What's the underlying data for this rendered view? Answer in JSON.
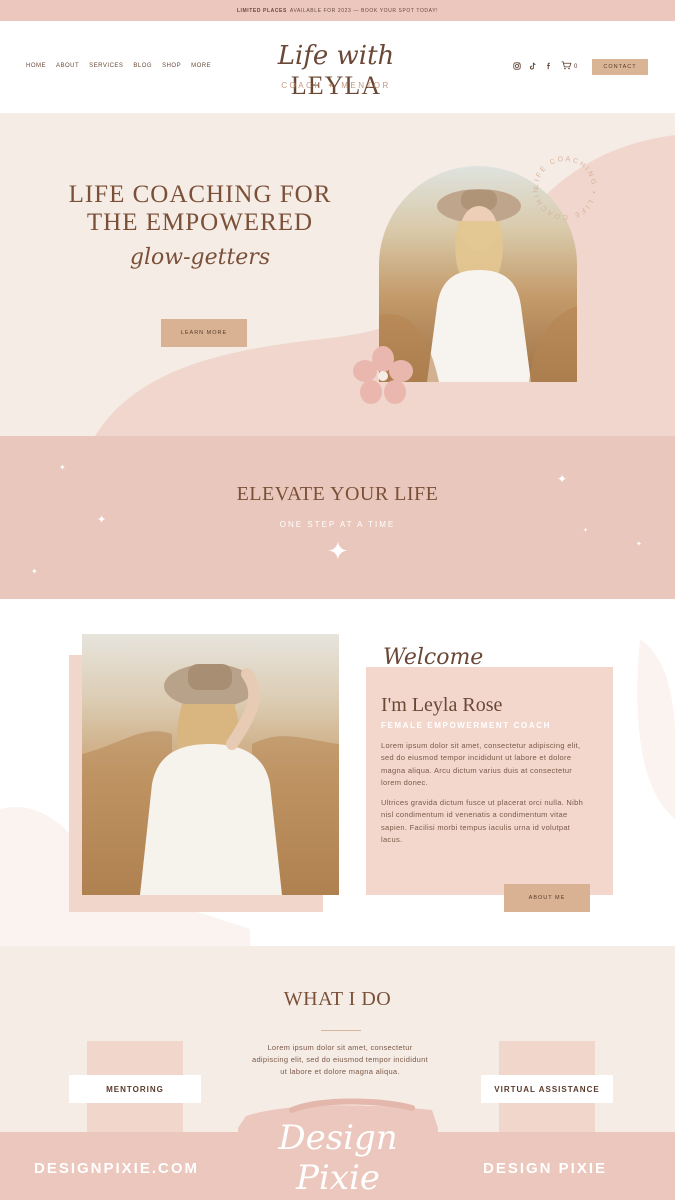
{
  "topbar": {
    "bold": "LIMITED PLACES",
    "rest": "AVAILABLE FOR 2023 — BOOK YOUR SPOT TODAY!"
  },
  "nav": [
    "HOME",
    "ABOUT",
    "SERVICES",
    "BLOG",
    "SHOP",
    "MORE"
  ],
  "logo": {
    "script": "Life with",
    "caps": "LEYLA",
    "sub": "COACH ✦ MENTOR"
  },
  "header": {
    "cart_count": "0",
    "contact": "CONTACT"
  },
  "hero": {
    "title_line1": "LIFE COACHING FOR",
    "title_line2": "THE EMPOWERED",
    "script": "glow-getters",
    "button": "LEARN MORE",
    "circle_text": "LIFE COACHING • LIFE COACHING •"
  },
  "elevate": {
    "title": "ELEVATE YOUR LIFE",
    "subtitle": "ONE STEP AT A TIME"
  },
  "about": {
    "script": "Welcome",
    "name": "I'm Leyla Rose",
    "role": "FEMALE EMPOWERMENT COACH",
    "p1": "Lorem ipsum dolor sit amet, consectetur adipiscing elit, sed do eiusmod tempor incididunt ut labore et dolore magna aliqua. Arcu dictum varius duis at consectetur lorem donec.",
    "p2": "Ultrices gravida dictum fusce ut placerat orci nulla. Nibh nisl condimentum id venenatis a condimentum vitae sapien. Facilisi morbi tempus iaculis urna id volutpat lacus.",
    "button": "ABOUT ME"
  },
  "services": {
    "title": "WHAT I DO",
    "text": "Lorem ipsum dolor sit amet, consectetur adipiscing elit, sed do eiusmod tempor incididunt ut labore et dolore magna aliqua.",
    "left": "MENTORING",
    "right": "VIRTUAL ASSISTANCE"
  },
  "footer": {
    "left": "DESIGNPIXIE.COM",
    "right": "DESIGN PIXIE",
    "brand": "Design Pixie"
  },
  "colors": {
    "accent": "#d8b293",
    "blush": "#e9c7bd",
    "brown": "#7a5038",
    "cream": "#f6ece6"
  }
}
